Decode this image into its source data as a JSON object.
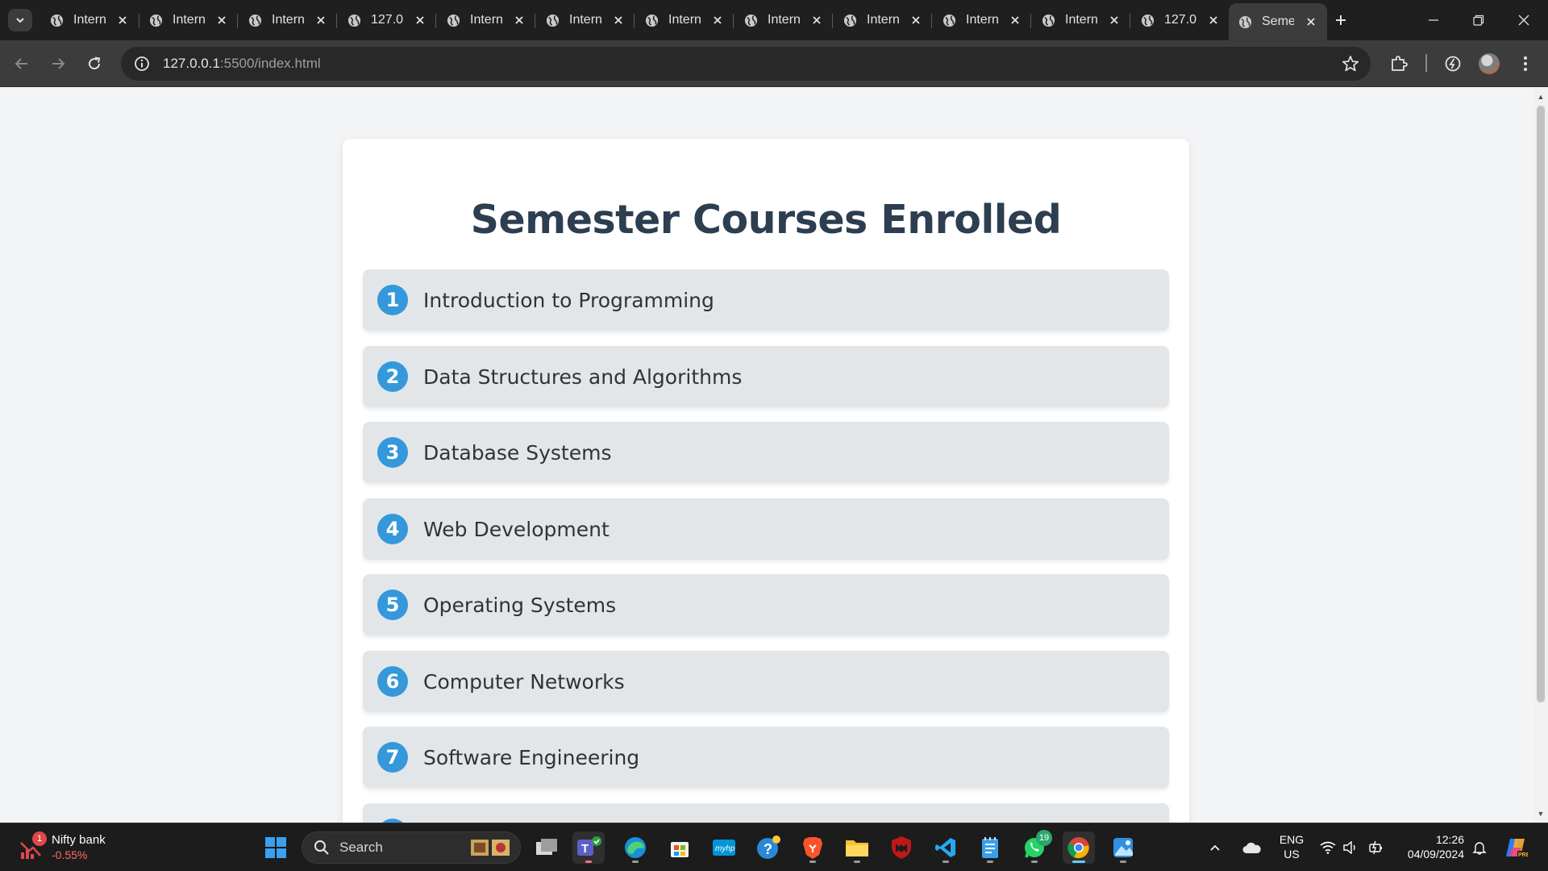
{
  "browser": {
    "tabs": [
      {
        "title": "Intern"
      },
      {
        "title": "Intern"
      },
      {
        "title": "Intern"
      },
      {
        "title": "127.0"
      },
      {
        "title": "Intern"
      },
      {
        "title": "Intern"
      },
      {
        "title": "Intern"
      },
      {
        "title": "Intern"
      },
      {
        "title": "Intern"
      },
      {
        "title": "Intern"
      },
      {
        "title": "Intern"
      },
      {
        "title": "127.0"
      },
      {
        "title": "Seme"
      }
    ],
    "url_host": "127.0.0.1",
    "url_rest": ":5500/index.html"
  },
  "page": {
    "title": "Semester Courses Enrolled",
    "courses": [
      {
        "num": "1",
        "name": "Introduction to Programming"
      },
      {
        "num": "2",
        "name": "Data Structures and Algorithms"
      },
      {
        "num": "3",
        "name": "Database Systems"
      },
      {
        "num": "4",
        "name": "Web Development"
      },
      {
        "num": "5",
        "name": "Operating Systems"
      },
      {
        "num": "6",
        "name": "Computer Networks"
      },
      {
        "num": "7",
        "name": "Software Engineering"
      }
    ],
    "accent_color": "#3498db",
    "title_color": "#2c3e50"
  },
  "taskbar": {
    "widget": {
      "badge": "1",
      "name": "Nifty bank",
      "value": "-0.55%"
    },
    "search_label": "Search",
    "whatsapp_badge": "19",
    "language": "ENG",
    "region": "US",
    "time": "12:26",
    "date": "04/09/2024"
  }
}
